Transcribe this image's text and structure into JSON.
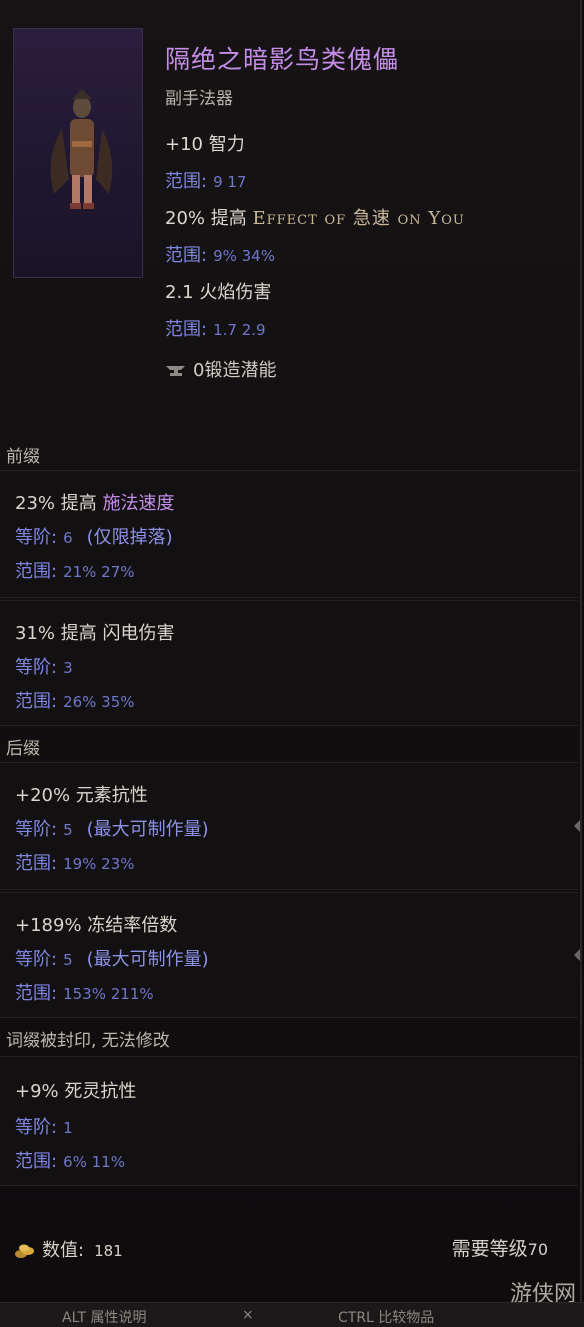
{
  "item": {
    "name": "隔绝之暗影鸟类傀儡",
    "type": "副手法器",
    "stats": [
      {
        "text": "+10 智力",
        "range_label": "范围:",
        "range_values": "9  17"
      },
      {
        "text_pre": "20% 提高 ",
        "text_sc": "Effect of 急速 on You",
        "range_label": "范围:",
        "range_values": "9%  34%"
      },
      {
        "text": "2.1 火焰伤害",
        "range_label": "范围:",
        "range_values": "1.7  2.9"
      }
    ],
    "forge_potential": "0锻造潜能"
  },
  "prefix": {
    "label": "前缀",
    "affixes": [
      {
        "pre": "23% 提高 ",
        "hl": "施法速度",
        "tier_label": "等阶:",
        "tier": "6",
        "tier_note": "(仅限掉落)",
        "range_label": "范围:",
        "range": "21%  27%"
      },
      {
        "pre": "31% 提高 闪电伤害",
        "hl": "",
        "tier_label": "等阶:",
        "tier": "3",
        "tier_note": "",
        "range_label": "范围:",
        "range": "26%  35%"
      }
    ]
  },
  "suffix": {
    "label": "后缀",
    "affixes": [
      {
        "pre": "+20% 元素抗性",
        "tier_label": "等阶:",
        "tier": "5",
        "tier_note": "(最大可制作量)",
        "range_label": "范围:",
        "range": "19%  23%"
      },
      {
        "pre": "+189% 冻结率倍数",
        "tier_label": "等阶:",
        "tier": "5",
        "tier_note": "(最大可制作量)",
        "range_label": "范围:",
        "range": "153%  211%"
      }
    ]
  },
  "sealed": {
    "label": "词缀被封印, 无法修改",
    "affix": {
      "pre": "+9% 死灵抗性",
      "tier_label": "等阶:",
      "tier": "1",
      "range_label": "范围:",
      "range": "6%  11%"
    }
  },
  "footer": {
    "value_label": "数值:",
    "value": "181",
    "level_label": "需要等级",
    "level": "70"
  },
  "bottom_bar": {
    "alt": "ALT  属性说明",
    "ctrl": "CTRL  比较物品"
  },
  "watermark": "游侠网"
}
